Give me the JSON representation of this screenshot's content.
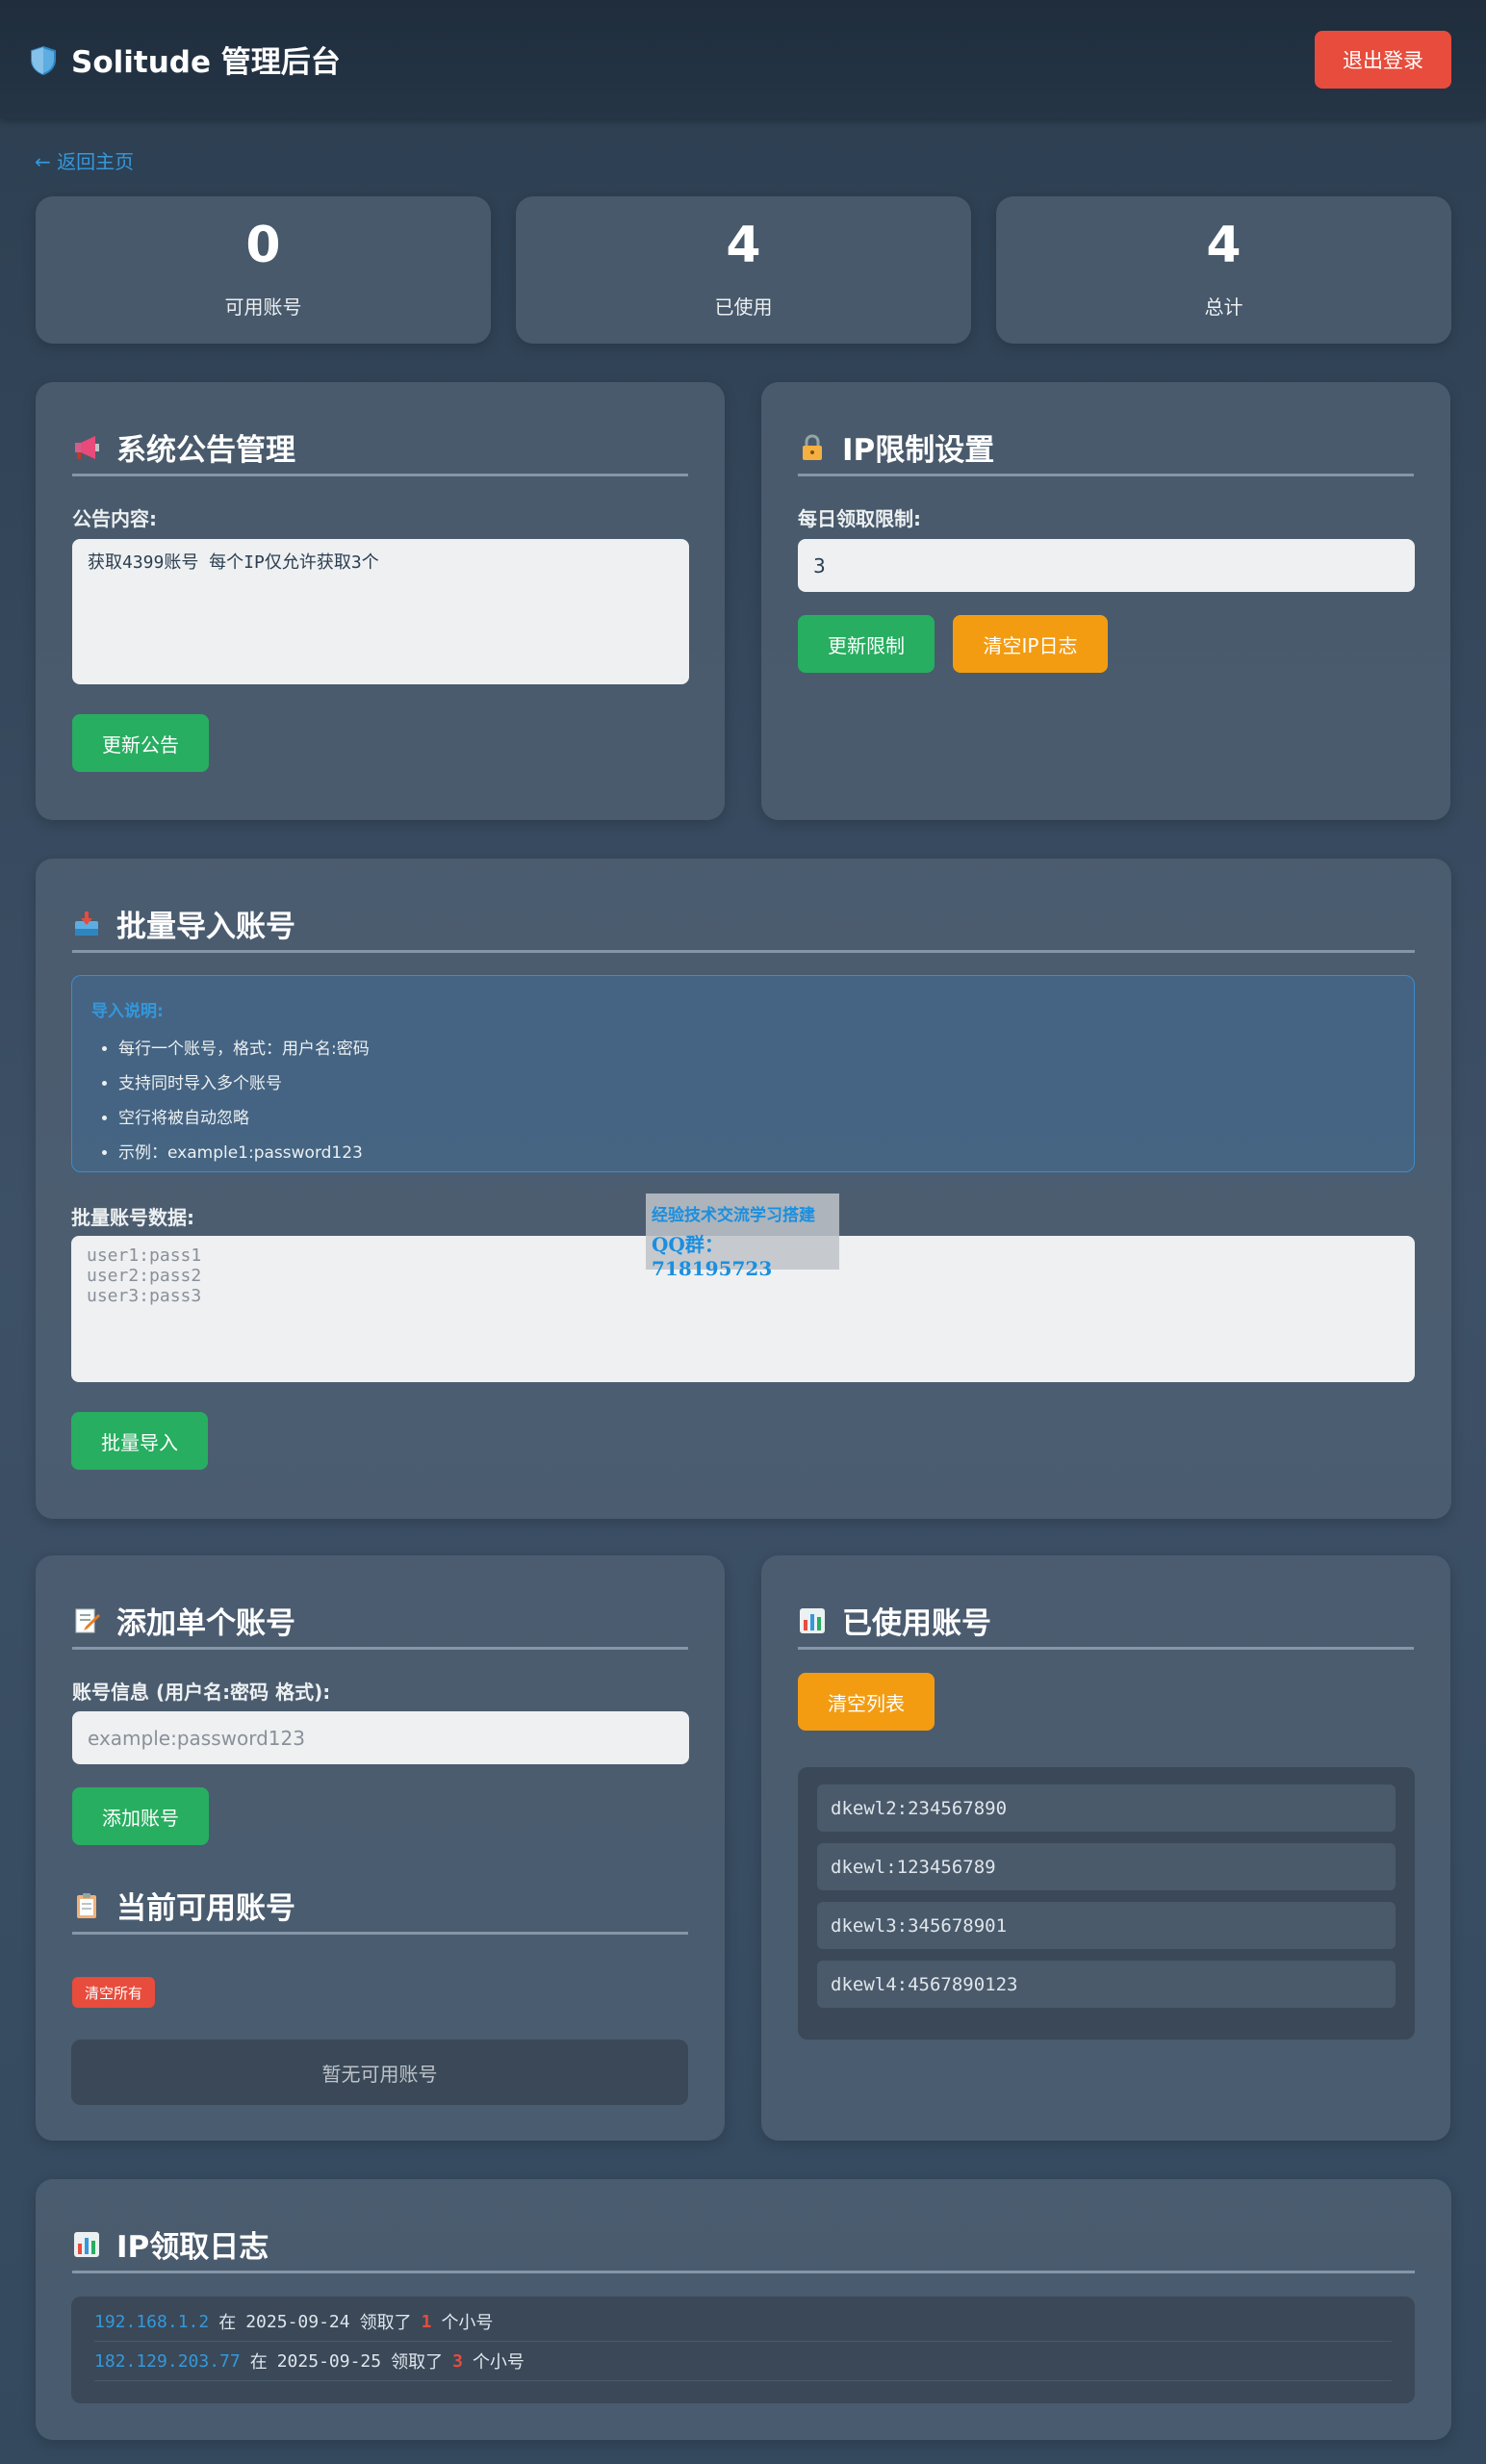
{
  "header": {
    "title": "Solitude 管理后台",
    "logout_label": "退出登录"
  },
  "nav": {
    "back_label": "← 返回主页"
  },
  "stats": [
    {
      "value": "0",
      "label": "可用账号"
    },
    {
      "value": "4",
      "label": "已使用"
    },
    {
      "value": "4",
      "label": "总计"
    }
  ],
  "announcement": {
    "title": "系统公告管理",
    "field_label": "公告内容:",
    "content": "获取4399账号 每个IP仅允许获取3个",
    "button_label": "更新公告"
  },
  "ip_limit": {
    "title": "IP限制设置",
    "field_label": "每日领取限制:",
    "value": "3",
    "update_label": "更新限制",
    "clear_label": "清空IP日志"
  },
  "batch_import": {
    "title": "批量导入账号",
    "info_title": "导入说明:",
    "info_items": [
      "每行一个账号，格式：用户名:密码",
      "支持同时导入多个账号",
      "空行将被自动忽略",
      "示例：example1:password123"
    ],
    "field_label": "批量账号数据:",
    "placeholder_lines": [
      "user1:pass1",
      "user2:pass2",
      "user3:pass3"
    ],
    "button_label": "批量导入"
  },
  "watermark": {
    "line1": "经验技术交流学习搭建",
    "line2": "QQ群：718195723"
  },
  "add_single": {
    "title": "添加单个账号",
    "field_label": "账号信息 (用户名:密码 格式):",
    "placeholder": "example:password123",
    "button_label": "添加账号"
  },
  "available": {
    "title": "当前可用账号",
    "clear_all_label": "清空所有",
    "empty_text": "暂无可用账号"
  },
  "used_accounts": {
    "title": "已使用账号",
    "clear_label": "清空列表",
    "items": [
      "dkewl2:234567890",
      "dkewl:123456789",
      "dkewl3:345678901",
      "dkewl4:4567890123"
    ]
  },
  "ip_log": {
    "title": "IP领取日志",
    "entries": [
      {
        "ip": "192.168.1.2",
        "at": "在",
        "date": "2025-09-24",
        "got": "领取了",
        "count": "1",
        "unit": "个小号"
      },
      {
        "ip": "182.129.203.77",
        "at": "在",
        "date": "2025-09-25",
        "got": "领取了",
        "count": "3",
        "unit": "个小号"
      }
    ]
  },
  "icons": {
    "brand": "shield-icon",
    "announcement": "megaphone-icon",
    "ip_limit": "lock-icon",
    "batch_import": "inbox-tray-icon",
    "add_single": "memo-icon",
    "available": "clipboard-icon",
    "used": "bar-chart-icon",
    "ip_log": "bar-chart-icon"
  },
  "colors": {
    "accent_blue": "#3498db",
    "green": "#27ae60",
    "orange": "#f39c12",
    "red": "#e74c3c"
  }
}
